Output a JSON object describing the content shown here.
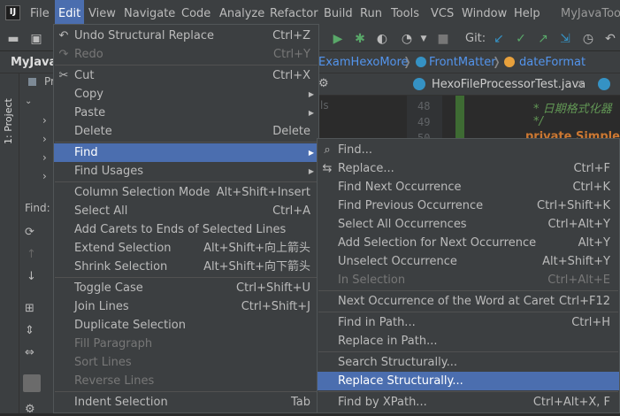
{
  "menubar": {
    "items": [
      "File",
      "Edit",
      "View",
      "Navigate",
      "Code",
      "Analyze",
      "Refactor",
      "Build",
      "Run",
      "Tools",
      "VCS",
      "Window",
      "Help"
    ],
    "title": "MyJavaToo"
  },
  "toolbar": {
    "git_label": "Git:"
  },
  "navbar": {
    "project_label": "MyJava",
    "crumbs": [
      "ExamHexoMore",
      "FrontMatter",
      "dateFormat"
    ]
  },
  "left_strip": {
    "project_tab": "1: Project",
    "find_label": "Find:"
  },
  "project_panel": {
    "title": "Pr"
  },
  "editor": {
    "tab_label": "HexoFileProcessorTest.java",
    "side_text": "ls",
    "lines": [
      {
        "num": "48",
        "code": "* 日期格式化器"
      },
      {
        "num": "49",
        "code": "*/"
      },
      {
        "num": "50",
        "code": "private Simple"
      }
    ]
  },
  "edit_menu": {
    "items": [
      {
        "label": "Undo Structural Replace",
        "shortcut": "Ctrl+Z",
        "icon": "undo-icon"
      },
      {
        "label": "Redo",
        "shortcut": "Ctrl+Y",
        "icon": "redo-icon",
        "disabled": true
      },
      {
        "label": "Cut",
        "shortcut": "Ctrl+X",
        "icon": "scissors-icon"
      },
      {
        "label": "Copy",
        "shortcut": "",
        "submenu": true
      },
      {
        "label": "Paste",
        "shortcut": "",
        "submenu": true
      },
      {
        "label": "Delete",
        "shortcut": "Delete"
      },
      {
        "label": "Find",
        "shortcut": "",
        "submenu": true,
        "highlighted": true
      },
      {
        "label": "Find Usages",
        "shortcut": "",
        "submenu": true
      },
      {
        "label": "Column Selection Mode",
        "shortcut": "Alt+Shift+Insert"
      },
      {
        "label": "Select All",
        "shortcut": "Ctrl+A"
      },
      {
        "label": "Add Carets to Ends of Selected Lines",
        "shortcut": ""
      },
      {
        "label": "Extend Selection",
        "shortcut": "Alt+Shift+向上箭头"
      },
      {
        "label": "Shrink Selection",
        "shortcut": "Alt+Shift+向下箭头"
      },
      {
        "label": "Toggle Case",
        "shortcut": "Ctrl+Shift+U"
      },
      {
        "label": "Join Lines",
        "shortcut": "Ctrl+Shift+J"
      },
      {
        "label": "Duplicate Selection",
        "shortcut": ""
      },
      {
        "label": "Fill Paragraph",
        "shortcut": "",
        "disabled": true
      },
      {
        "label": "Sort Lines",
        "shortcut": "",
        "disabled": true
      },
      {
        "label": "Reverse Lines",
        "shortcut": "",
        "disabled": true
      },
      {
        "label": "Indent Selection",
        "shortcut": "Tab"
      }
    ]
  },
  "find_menu": {
    "items": [
      {
        "label": "Find...",
        "shortcut": "",
        "icon": "search-icon"
      },
      {
        "label": "Replace...",
        "shortcut": "Ctrl+F",
        "icon": "replace-icon"
      },
      {
        "label": "Find Next Occurrence",
        "shortcut": "Ctrl+K"
      },
      {
        "label": "Find Previous Occurrence",
        "shortcut": "Ctrl+Shift+K"
      },
      {
        "label": "Select All Occurrences",
        "shortcut": "Ctrl+Alt+Y"
      },
      {
        "label": "Add Selection for Next Occurrence",
        "shortcut": "Alt+Y"
      },
      {
        "label": "Unselect Occurrence",
        "shortcut": "Alt+Shift+Y"
      },
      {
        "label": "In Selection",
        "shortcut": "Ctrl+Alt+E",
        "disabled": true
      },
      {
        "label": "Next Occurrence of the Word at Caret",
        "shortcut": "Ctrl+F12"
      },
      {
        "label": "Find in Path...",
        "shortcut": "Ctrl+H"
      },
      {
        "label": "Replace in Path...",
        "shortcut": ""
      },
      {
        "label": "Search Structurally...",
        "shortcut": ""
      },
      {
        "label": "Replace Structurally...",
        "shortcut": "",
        "highlighted": true
      },
      {
        "label": "Find by XPath...",
        "shortcut": "Ctrl+Alt+X, F"
      }
    ]
  },
  "colors": {
    "accent": "#4b6eaf",
    "menu_bg": "#3c3f41",
    "editor_bg": "#2b2b2b",
    "text": "#bbbbbb",
    "disabled": "#777777"
  }
}
